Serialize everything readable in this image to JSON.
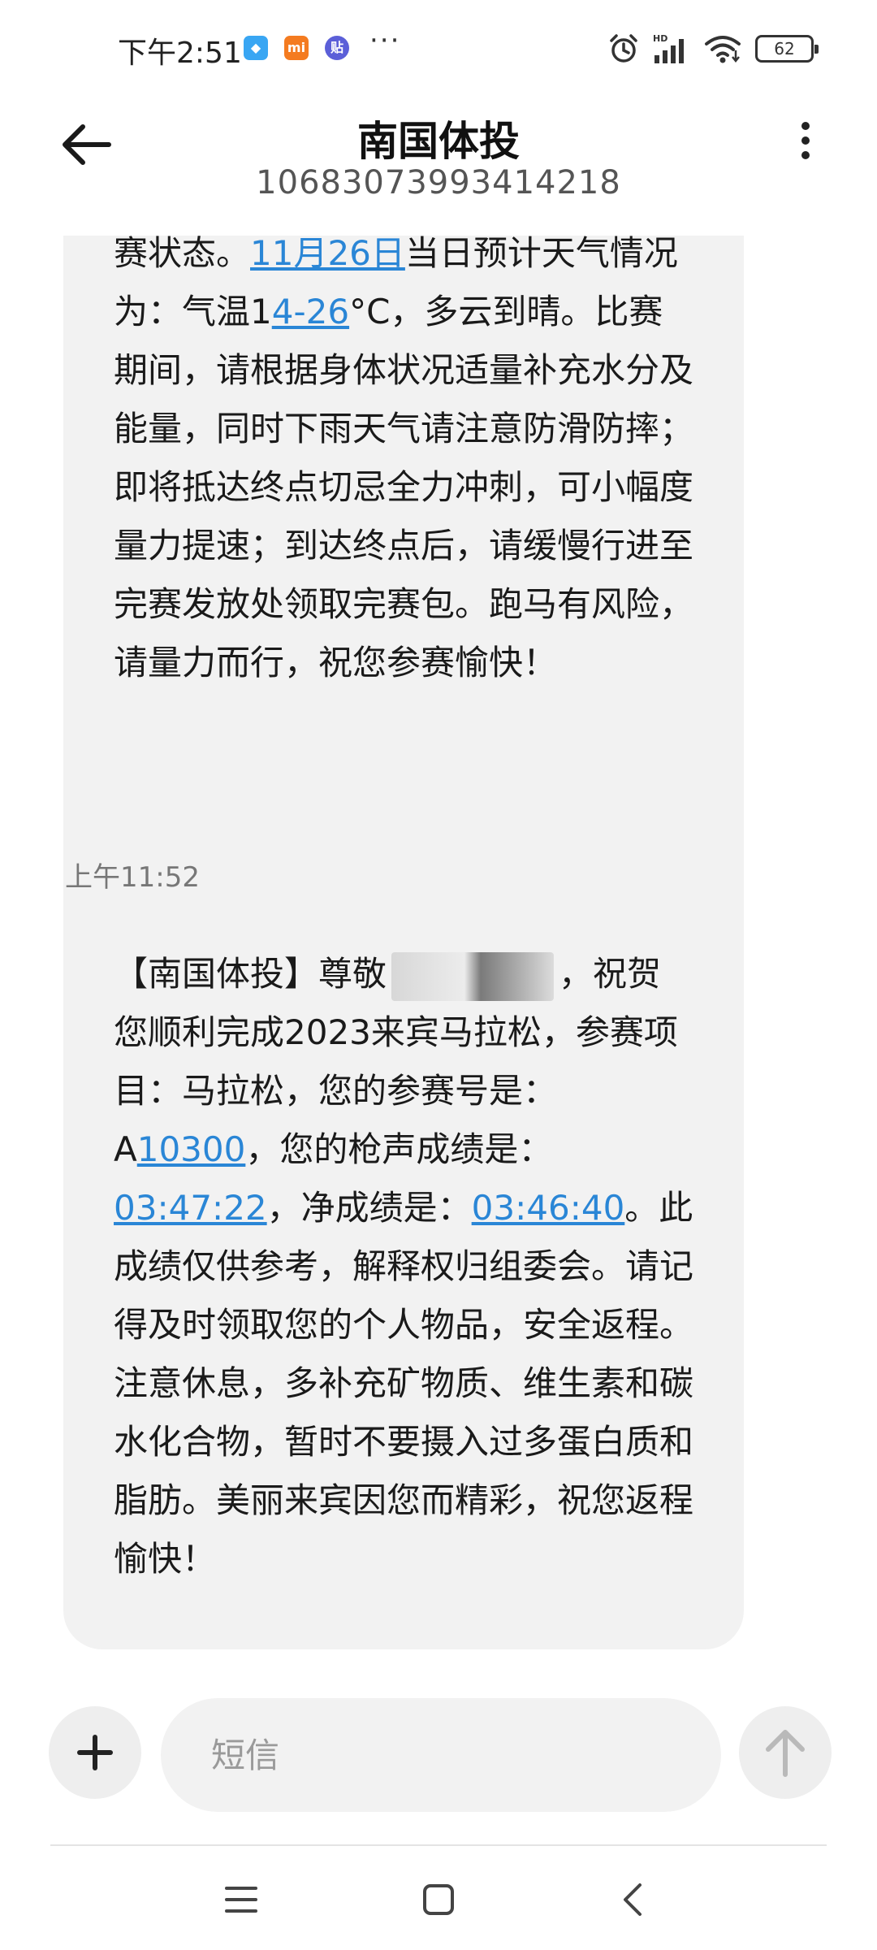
{
  "status_bar": {
    "time": "下午2:51",
    "more": "···",
    "battery": "62",
    "signal": "HD"
  },
  "header": {
    "title": "南国体投",
    "number": "10683073993414218"
  },
  "messages": [
    {
      "segments": [
        {
          "text": "赛状态。"
        },
        {
          "text": "11月26日",
          "link": true
        },
        {
          "text": "当日预计天气情况为：气温1"
        },
        {
          "text": "4-26",
          "link": true
        },
        {
          "text": "°C，多云到晴。比赛期间，请根据身体状况适量补充水分及能量，同时下雨天气请注意防滑防摔；即将抵达终点切忌全力冲刺，可小幅度量力提速；到达终点后，请缓慢行进至完赛发放处领取完赛包。跑马有风险，请量力而行，祝您参赛愉快！"
        }
      ]
    },
    {
      "timestamp": "上午11:52",
      "segments": [
        {
          "text": "【南国体投】尊敬"
        },
        {
          "redacted": true
        },
        {
          "text": "，祝贺您顺利完成2023来宾马拉松，参赛项目：马拉松，您的参赛号是：A"
        },
        {
          "text": "10300",
          "link": true
        },
        {
          "text": "，您的枪声成绩是："
        },
        {
          "text": "03:47:22",
          "link": true
        },
        {
          "text": "，净成绩是："
        },
        {
          "text": "03:46:40",
          "link": true
        },
        {
          "text": "。此成绩仅供参考，解释权归组委会。请记得及时领取您的个人物品，安全返程。注意休息，多补充矿物质、维生素和碳水化合物，暂时不要摄入过多蛋白质和脂肪。美丽来宾因您而精彩，祝您返程愉快！"
        }
      ]
    }
  ],
  "composer": {
    "placeholder": "短信"
  },
  "icons": {
    "back": "arrow-left-icon",
    "more": "vertical-dots-icon",
    "add": "plus-icon",
    "send": "arrow-up-icon",
    "nav_menu": "menu-lines-icon",
    "nav_home": "square-icon",
    "nav_back": "chevron-left-icon"
  },
  "colors": {
    "link": "#2a86d6",
    "bubble": "#f2f2f2"
  }
}
